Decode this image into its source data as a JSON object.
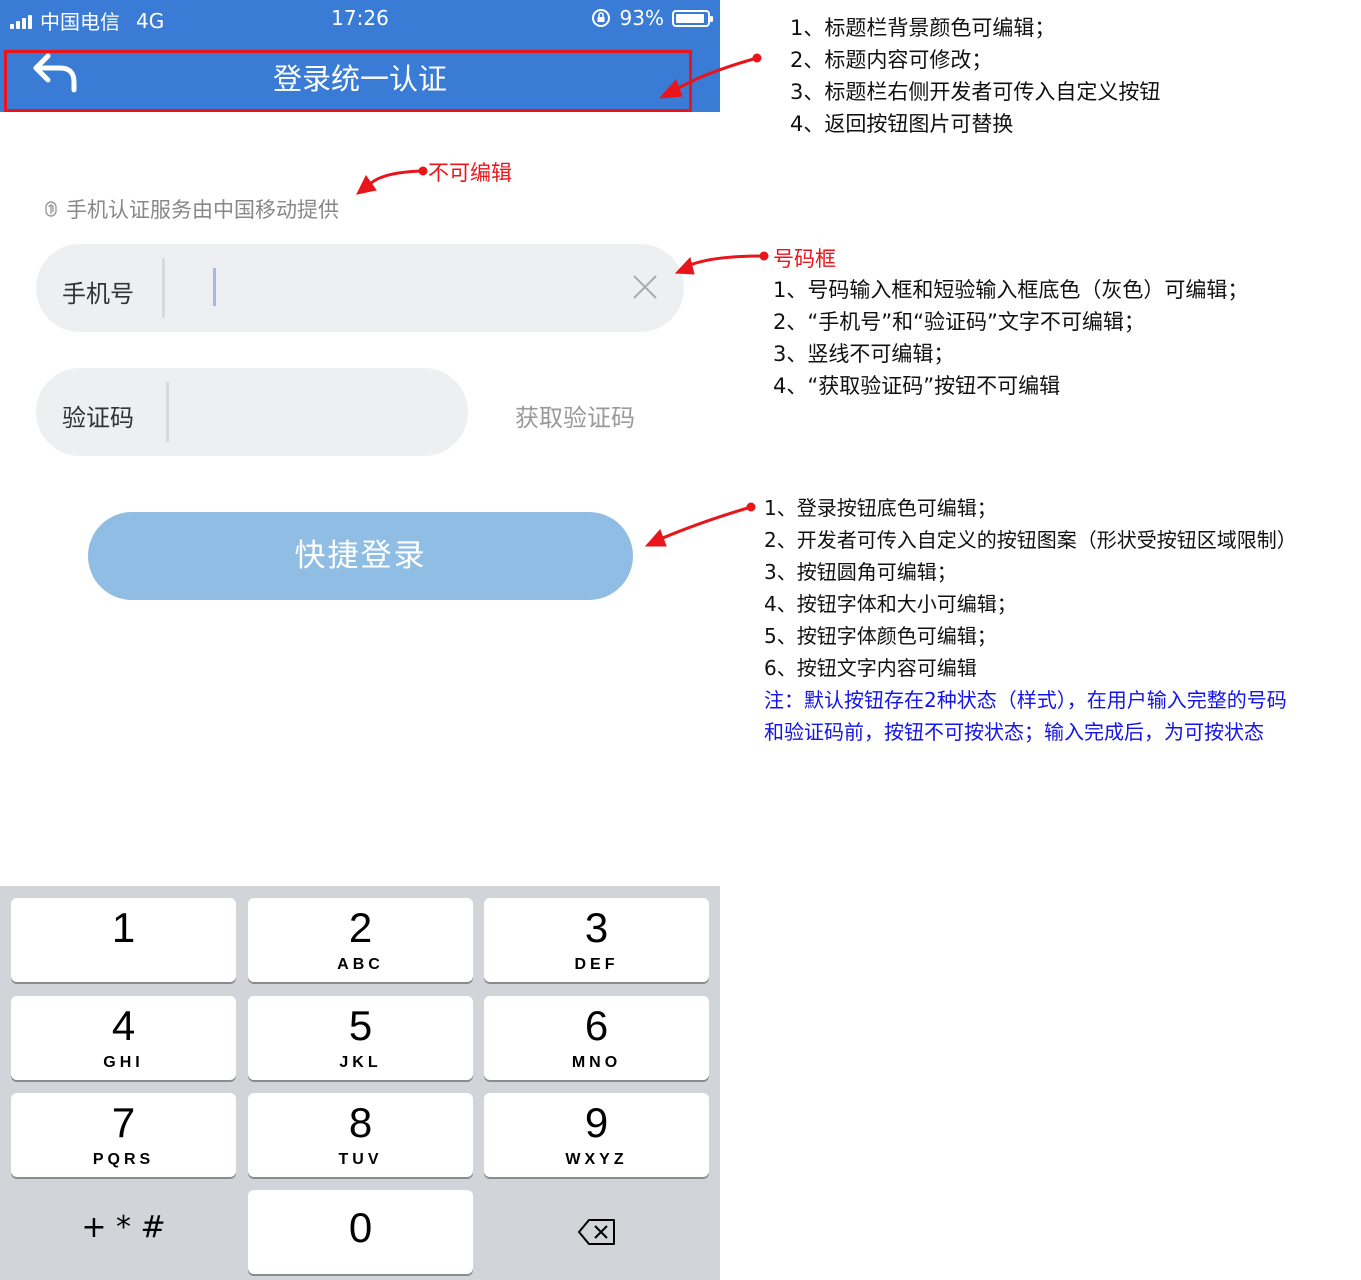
{
  "status_bar": {
    "carrier": "中国电信",
    "network": "4G",
    "time": "17:26",
    "battery": "93%",
    "battery_level": 0.93
  },
  "title_bar": {
    "title": "登录统一认证",
    "back_icon": "back-arrow-icon",
    "background_color": "#3a7bd5"
  },
  "provider_notice": {
    "icon": "fingerprint-icon",
    "text": "手机认证服务由中国移动提供"
  },
  "phone_field": {
    "label": "手机号",
    "value": "",
    "clear_icon": "close-icon"
  },
  "code_field": {
    "label": "验证码",
    "value": "",
    "get_code_label": "获取验证码"
  },
  "login_button": {
    "label": "快捷登录",
    "color": "#8fbde3"
  },
  "keypad": {
    "keys": [
      {
        "num": "1",
        "letters": ""
      },
      {
        "num": "2",
        "letters": "ABC"
      },
      {
        "num": "3",
        "letters": "DEF"
      },
      {
        "num": "4",
        "letters": "GHI"
      },
      {
        "num": "5",
        "letters": "JKL"
      },
      {
        "num": "6",
        "letters": "MNO"
      },
      {
        "num": "7",
        "letters": "PQRS"
      },
      {
        "num": "8",
        "letters": "TUV"
      },
      {
        "num": "9",
        "letters": "WXYZ"
      }
    ],
    "symbols": "+ * #",
    "zero": "0",
    "delete_icon": "backspace-icon"
  },
  "annotations": {
    "title_bar": [
      "1、标题栏背景颜色可编辑；",
      "2、标题内容可修改；",
      "3、标题栏右侧开发者可传入自定义按钮",
      "4、返回按钮图片可替换"
    ],
    "not_editable": "不可编辑",
    "number_box_heading": "号码框",
    "number_box": [
      "1、号码输入框和短验输入框底色（灰色）可编辑；",
      "2、“手机号”和“验证码”文字不可编辑；",
      "3、竖线不可编辑；",
      "4、“获取验证码”按钮不可编辑"
    ],
    "login_button": [
      "1、登录按钮底色可编辑；",
      "2、开发者可传入自定义的按钮图案（形状受按钮区域限制）",
      "3、按钮圆角可编辑；",
      "4、按钮字体和大小可编辑；",
      "5、按钮字体颜色可编辑；",
      "6、按钮文字内容可编辑"
    ],
    "note": [
      "注：默认按钮存在2种状态（样式），在用户输入完整的号码",
      "和验证码前，按钮不可按状态；输入完成后，为可按状态"
    ],
    "note_color": "#1414e6",
    "highlight_color": "#e8161b"
  }
}
